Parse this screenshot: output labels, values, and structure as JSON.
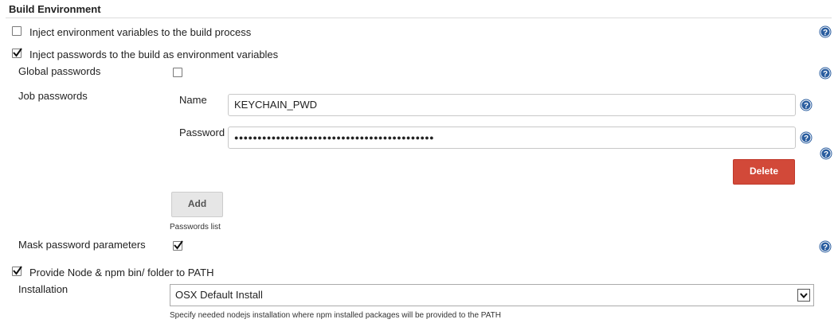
{
  "section": {
    "title": "Build Environment"
  },
  "options": {
    "inject_env": {
      "label": "Inject environment variables to the build process",
      "checked": false
    },
    "inject_passwords": {
      "label": "Inject passwords to the build as environment variables",
      "checked": true
    },
    "provide_node": {
      "label": "Provide Node & npm bin/ folder to PATH",
      "checked": true
    }
  },
  "global_passwords": {
    "label": "Global passwords",
    "checked": false
  },
  "job_passwords": {
    "label": "Job passwords",
    "name_label": "Name",
    "name_value": "KEYCHAIN_PWD",
    "password_label": "Password",
    "password_mask": "●●●●●●●●●●●●●●●●●●●●●●●●●●●●●●●●●●●●●●●●●●●",
    "delete_label": "Delete",
    "add_label": "Add",
    "list_caption": "Passwords list"
  },
  "mask_params": {
    "label": "Mask password parameters",
    "checked": true
  },
  "installation": {
    "label": "Installation",
    "selected": "OSX Default Install",
    "hint": "Specify needed nodejs installation where npm installed packages will be provided to the PATH"
  },
  "colors": {
    "help_icon": "#2a5d9f",
    "delete_button": "#d24939",
    "add_button": "#e6e6e6"
  },
  "icons": {
    "help": "help-icon",
    "check": "checkmark-icon",
    "dropdown": "chevron-down-icon"
  }
}
